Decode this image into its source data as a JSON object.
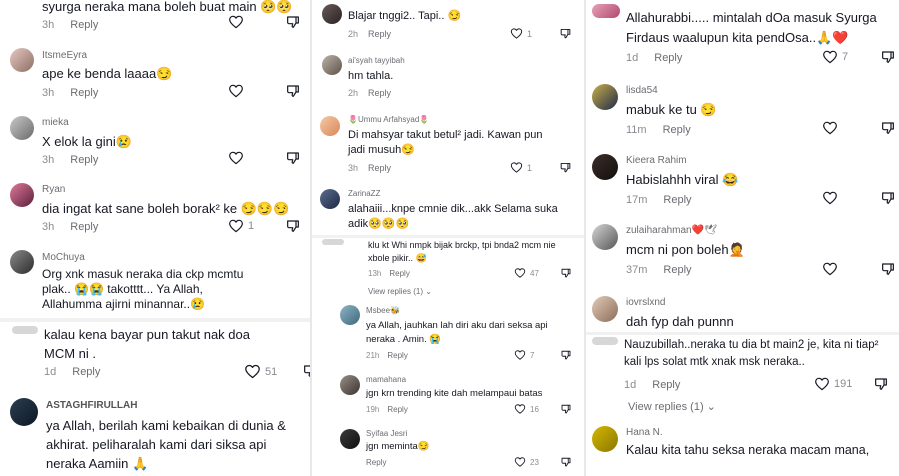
{
  "col1": {
    "c0": {
      "text": "syurga neraka mana boleh buat main 🥺🥺",
      "time": "3h",
      "reply": "Reply"
    },
    "c1": {
      "user": "ItsmeEyra",
      "text": "ape ke benda laaaa😏",
      "time": "3h",
      "reply": "Reply"
    },
    "c2": {
      "user": "mieka",
      "text": "X elok la gini😢",
      "time": "3h",
      "reply": "Reply"
    },
    "c3": {
      "user": "Ryan",
      "text": "dia ingat kat sane boleh borak² ke 😏😏😏",
      "time": "3h",
      "reply": "Reply",
      "likes": "1"
    },
    "c4": {
      "user": "MoChuya",
      "text": "Org xnk masuk neraka dia ckp mcmtu plak.. 😭😭 takotttt... Ya Allah, Allahumma ajirni minannar..😢",
      "time": "3h",
      "reply": "Reply"
    },
    "c5": {
      "text": "kalau kena bayar pun takut nak doa MCM ni .",
      "time": "1d",
      "reply": "Reply",
      "likes": "51"
    },
    "c6": {
      "user": "ASTAGHFIRULLAH",
      "text": "ya Allah, berilah kami kebaikan di dunia & akhirat. peliharalah kami dari siksa api neraka Aamiin 🙏"
    }
  },
  "col2": {
    "c0": {
      "text": "Blajar tnggi2.. Tapi.. 😏",
      "time": "2h",
      "reply": "Reply",
      "likes": "1"
    },
    "c1": {
      "user": "ai'syah tayyibah",
      "text": "hm tahla.",
      "time": "2h",
      "reply": "Reply"
    },
    "c2": {
      "user": "🌷Ummu Arfahsyad🌷",
      "text": "Di mahsyar takut betul² jadi. Kawan pun jadi musuh😏",
      "time": "3h",
      "reply": "Reply",
      "likes": "1"
    },
    "c3": {
      "user": "ZarinaZZ",
      "text": "alahaiii...knpe cmnie dik...akk Selama suka adik🥺🥺🥺"
    },
    "c4": {
      "text": "klu kt Whi nmpk bijak brckp, tpi bnda2 mcm nie xbole pikir.. 😅",
      "time": "13h",
      "reply": "Reply",
      "likes": "47",
      "view": "View replies (1)"
    },
    "c5": {
      "user": "Msbee🐝",
      "text": "ya Allah, jauhkan lah diri aku dari seksa api neraka . Amin. 😭",
      "time": "21h",
      "reply": "Reply",
      "likes": "7"
    },
    "c6": {
      "user": "mamahana",
      "text": "jgn krn trending kite dah melampaui batas",
      "time": "19h",
      "reply": "Reply",
      "likes": "16"
    },
    "c7": {
      "user": "Syifaa Jesri",
      "text": "jgn meminta😏",
      "time": "",
      "reply": "Reply",
      "likes": "23"
    }
  },
  "col3": {
    "c0": {
      "text": "Allahurabbi..... mintalah dOa masuk Syurga Firdaus waalupun kita pendOsa..🙏❤️",
      "time": "1d",
      "reply": "Reply",
      "likes": "7"
    },
    "c1": {
      "user": "lisda54",
      "text": "mabuk ke tu 😏",
      "time": "11m",
      "reply": "Reply"
    },
    "c2": {
      "user": "Kieera Rahim",
      "text": "Habislahhh viral 😂",
      "time": "17m",
      "reply": "Reply"
    },
    "c3": {
      "user": "zulaiharahman❤️🕊",
      "text": "mcm ni pon boleh🤦",
      "time": "37m",
      "reply": "Reply"
    },
    "c4": {
      "user": "iovrslxnd",
      "text": "dah fyp dah punnn"
    },
    "c5": {
      "text": "Nauzubillah..neraka tu dia bt main2 je, kita ni tiap² kali lps solat mtk xnak msk neraka..",
      "time": "1d",
      "reply": "Reply",
      "likes": "191",
      "view": "View replies (1)"
    },
    "c6": {
      "user": "Hana N.",
      "text": "Kalau kita tahu seksa neraka macam mana,"
    }
  },
  "colors": {
    "text": "#161823",
    "meta": "#8a8b91",
    "username": "#6b6c72",
    "divider": "#e8e8e8"
  },
  "icons": [
    "heart-icon",
    "dislike-icon",
    "chevron-down-icon"
  ]
}
